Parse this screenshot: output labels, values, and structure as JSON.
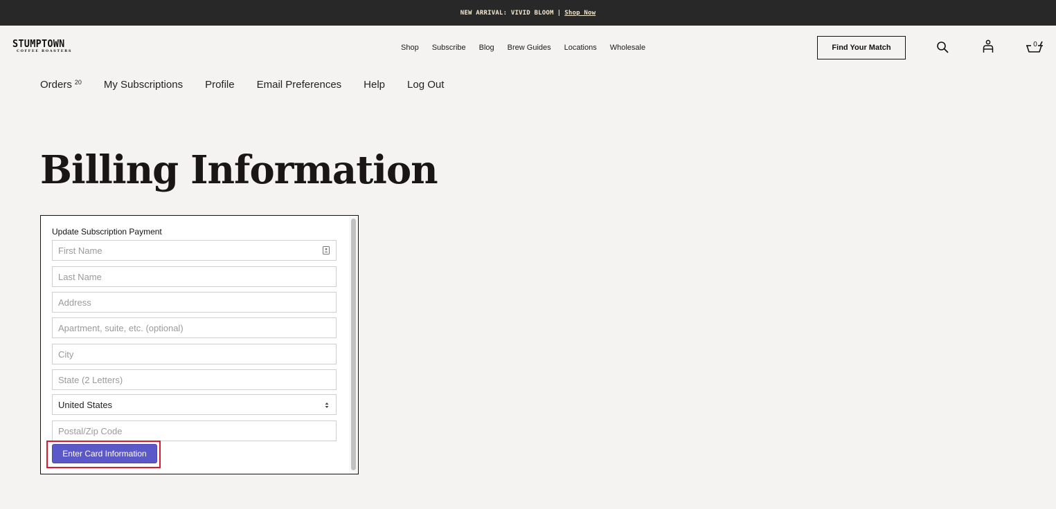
{
  "announcement": {
    "text": "NEW ARRIVAL: VIVID BLOOM",
    "separator": "|",
    "link": "Shop Now"
  },
  "header": {
    "logo_main": "STUMPTOWN",
    "logo_sub": "COFFEE ROASTERS",
    "nav": [
      "Shop",
      "Subscribe",
      "Blog",
      "Brew Guides",
      "Locations",
      "Wholesale"
    ],
    "match_button": "Find Your Match",
    "cart_count": "0",
    "icons": [
      "search-icon",
      "account-icon",
      "cart-icon"
    ]
  },
  "account_nav": {
    "orders_label": "Orders",
    "orders_count": "20",
    "subscriptions": "My Subscriptions",
    "profile": "Profile",
    "email_preferences": "Email Preferences",
    "help": "Help",
    "logout": "Log Out"
  },
  "page": {
    "title": "Billing Information"
  },
  "form": {
    "heading": "Update Subscription Payment",
    "first_name_placeholder": "First Name",
    "last_name_placeholder": "Last Name",
    "address_placeholder": "Address",
    "apartment_placeholder": "Apartment, suite, etc. (optional)",
    "city_placeholder": "City",
    "state_placeholder": "State (2 Letters)",
    "country_value": "United States",
    "zip_placeholder": "Postal/Zip Code",
    "submit_label": "Enter Card Information"
  },
  "colors": {
    "announcement_bg": "#282828",
    "announcement_text": "#f3e7cf",
    "page_bg": "#f4f3f1",
    "button_bg": "#5b58c7",
    "highlight": "#e0182d"
  }
}
